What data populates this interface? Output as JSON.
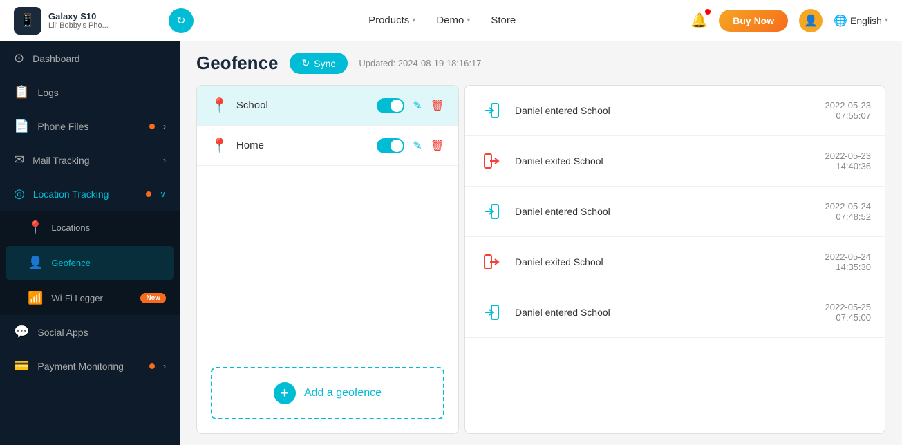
{
  "header": {
    "device_icon": "📱",
    "device_name": "Galaxy S10",
    "device_sub": "Lil' Bobby's Pho...",
    "sync_icon": "↻",
    "nav_items": [
      {
        "label": "Products",
        "has_chevron": true
      },
      {
        "label": "Demo",
        "has_chevron": true
      },
      {
        "label": "Store",
        "has_chevron": false
      }
    ],
    "buy_now_label": "Buy Now",
    "language": "English",
    "globe_icon": "🌐"
  },
  "sidebar": {
    "items": [
      {
        "id": "dashboard",
        "label": "Dashboard",
        "icon": "⊙",
        "has_dot": false,
        "has_arrow": false
      },
      {
        "id": "logs",
        "label": "Logs",
        "icon": "📋",
        "has_dot": false,
        "has_arrow": false
      },
      {
        "id": "phone-files",
        "label": "Phone Files",
        "icon": "📄",
        "has_dot": true,
        "has_arrow": true
      },
      {
        "id": "mail-tracking",
        "label": "Mail Tracking",
        "icon": "✉",
        "has_dot": false,
        "has_arrow": true
      },
      {
        "id": "location-tracking",
        "label": "Location Tracking",
        "icon": "◎",
        "has_dot": true,
        "has_arrow": true,
        "active": true
      }
    ],
    "sub_items": [
      {
        "id": "locations",
        "label": "Locations",
        "icon": "📍"
      },
      {
        "id": "geofence",
        "label": "Geofence",
        "icon": "👤",
        "active": true
      },
      {
        "id": "wifi-logger",
        "label": "Wi-Fi Logger",
        "icon": "📶",
        "badge": "New"
      }
    ],
    "bottom_items": [
      {
        "id": "social-apps",
        "label": "Social Apps",
        "icon": "💬",
        "has_dot": false
      },
      {
        "id": "payment-monitoring",
        "label": "Payment Monitoring",
        "icon": "💳",
        "has_dot": true,
        "has_arrow": true
      }
    ]
  },
  "geofence": {
    "title": "Geofence",
    "sync_label": "Sync",
    "updated_text": "Updated: 2024-08-19 18:16:17",
    "fences": [
      {
        "name": "School",
        "enabled": true,
        "selected": true
      },
      {
        "name": "Home",
        "enabled": true,
        "selected": false
      }
    ],
    "add_label": "Add a geofence",
    "events": [
      {
        "type": "enter",
        "desc": "Daniel entered School",
        "time": "2022-05-23\n07:55:07"
      },
      {
        "type": "exit",
        "desc": "Daniel exited School",
        "time": "2022-05-23\n14:40:36"
      },
      {
        "type": "enter",
        "desc": "Daniel entered School",
        "time": "2022-05-24\n07:48:52"
      },
      {
        "type": "exit",
        "desc": "Daniel exited School",
        "time": "2022-05-24\n14:35:30"
      },
      {
        "type": "enter",
        "desc": "Daniel entered School",
        "time": "2022-05-25\n07:45:00"
      }
    ]
  }
}
